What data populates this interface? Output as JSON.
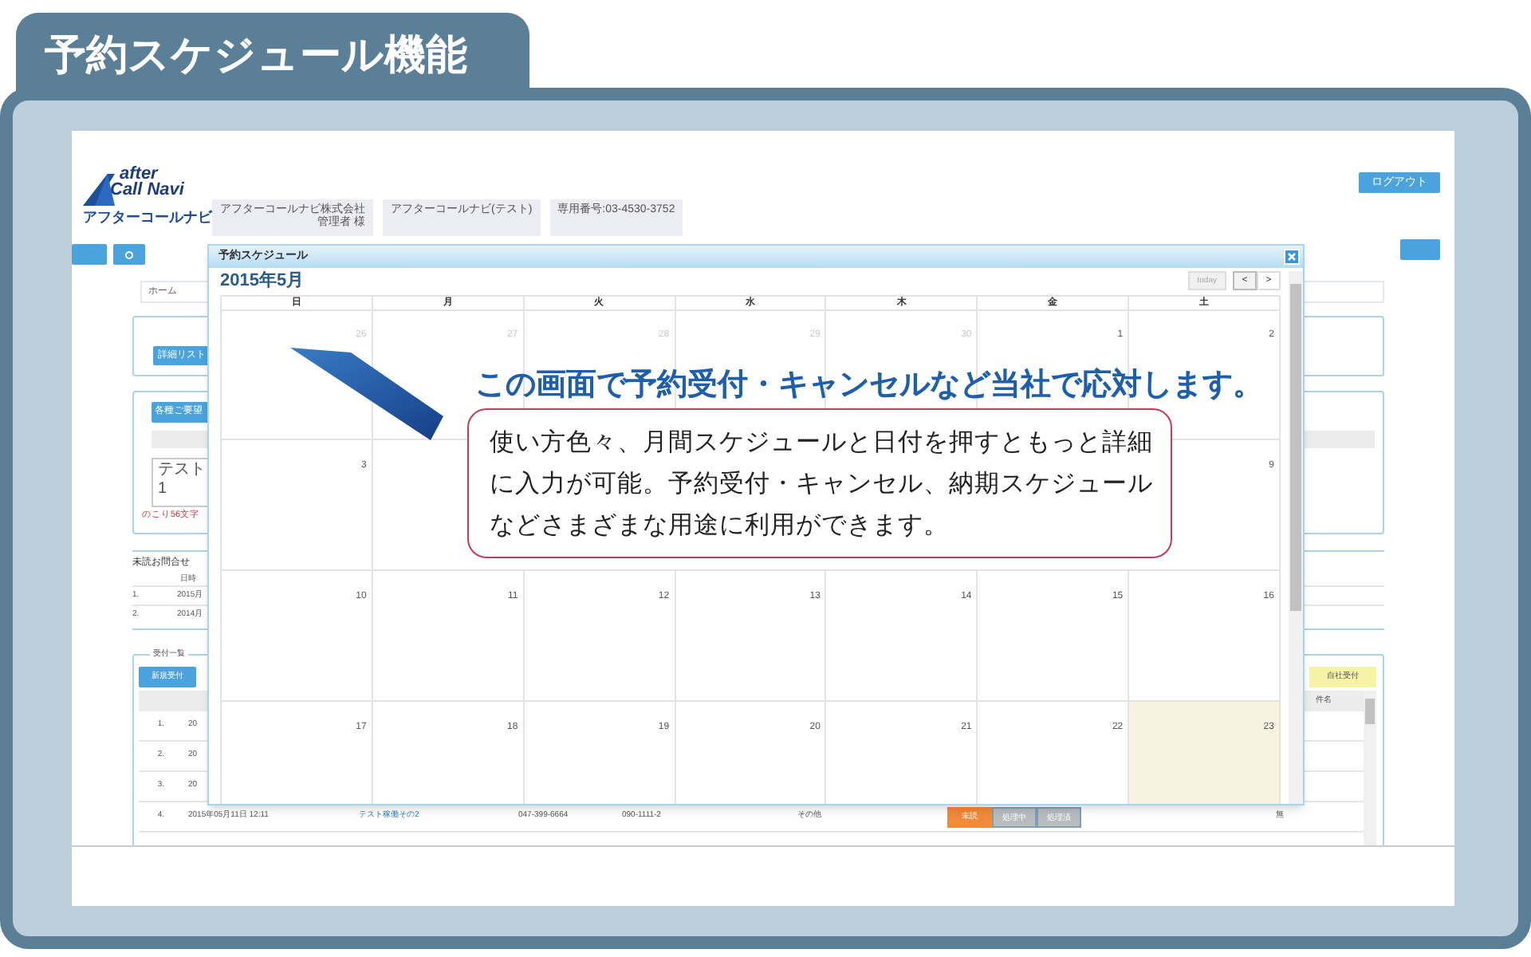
{
  "banner": {
    "title": "予約スケジュール機能"
  },
  "app": {
    "logo": {
      "line1": "after",
      "line2": "Call Navi",
      "kana": "アフターコールナビ"
    },
    "info_boxes": [
      {
        "lines": [
          "アフターコールナビ株式会社",
          "管理者 様"
        ]
      },
      {
        "lines": [
          "アフターコールナビ(テスト)"
        ]
      },
      {
        "lines": [
          "専用番号:03-4530-3752"
        ]
      }
    ],
    "logout_button": "ログアウト",
    "breadcrumb": "ホーム",
    "list_button": "詳細リスト",
    "request_panel": {
      "button": "各種ご要望",
      "memo": "テスト1",
      "remaining": "のこり56文字"
    },
    "mail_panel": {
      "title": "未読お問合せ",
      "column": "日時",
      "rows": [
        {
          "no": "1.",
          "date": "2015月"
        },
        {
          "no": "2.",
          "date": "2014月"
        }
      ]
    },
    "orders": {
      "legend": "受付一覧",
      "new_button": "新規受付",
      "own_button": "自社受付",
      "column_right": "件名",
      "rows": [
        {
          "no": "1.",
          "cells": [
            "20"
          ]
        },
        {
          "no": "2.",
          "cells": [
            "20"
          ]
        },
        {
          "no": "3.",
          "cells": [
            "20"
          ]
        },
        {
          "no": "4.",
          "cells": [
            "2015年05月11日 12:11",
            "テスト稼働その2",
            "047-399-6664",
            "090-1111-2",
            "その他"
          ],
          "statuses": [
            {
              "label": "未読",
              "selected": true
            },
            {
              "label": "処理中",
              "selected": false
            },
            {
              "label": "処理済",
              "selected": false
            }
          ],
          "flag": "無"
        }
      ]
    }
  },
  "modal": {
    "title": "予約スケジュール",
    "month": "2015年5月",
    "today_button": "today",
    "prev": "<",
    "next": ">",
    "weekdays": [
      "日",
      "月",
      "火",
      "水",
      "木",
      "金",
      "土"
    ],
    "weeks": [
      [
        {
          "day": "26",
          "muted": true
        },
        {
          "day": "27",
          "muted": true
        },
        {
          "day": "28",
          "muted": true
        },
        {
          "day": "29",
          "muted": true
        },
        {
          "day": "30",
          "muted": true
        },
        {
          "day": "1",
          "muted": false
        },
        {
          "day": "2",
          "muted": false
        }
      ],
      [
        {
          "day": "3",
          "muted": false
        },
        {
          "kind": "covered"
        },
        {
          "kind": "covered"
        },
        {
          "kind": "covered"
        },
        {
          "kind": "covered"
        },
        {
          "kind": "covered"
        },
        {
          "day": "9",
          "muted": false
        }
      ],
      [
        {
          "day": "10",
          "muted": false
        },
        {
          "day": "11",
          "muted": false
        },
        {
          "day": "12",
          "muted": false
        },
        {
          "day": "13",
          "muted": false
        },
        {
          "day": "14",
          "muted": false
        },
        {
          "day": "15",
          "muted": false
        },
        {
          "day": "16",
          "muted": false
        }
      ],
      [
        {
          "day": "17",
          "muted": false
        },
        {
          "day": "18",
          "muted": false
        },
        {
          "day": "19",
          "muted": false
        },
        {
          "day": "20",
          "muted": false
        },
        {
          "day": "21",
          "muted": false
        },
        {
          "day": "22",
          "muted": false
        },
        {
          "day": "23",
          "muted": false,
          "today": true
        }
      ]
    ]
  },
  "callout": {
    "headline": "この画面で予約受付・キャンセルなど当社で応対します。",
    "body": "使い方色々、月間スケジュールと日付を押すともっと詳細に入力が可能。予約受付・キャンセル、納期スケジュールなどさまざまな用途に利用ができます。"
  }
}
